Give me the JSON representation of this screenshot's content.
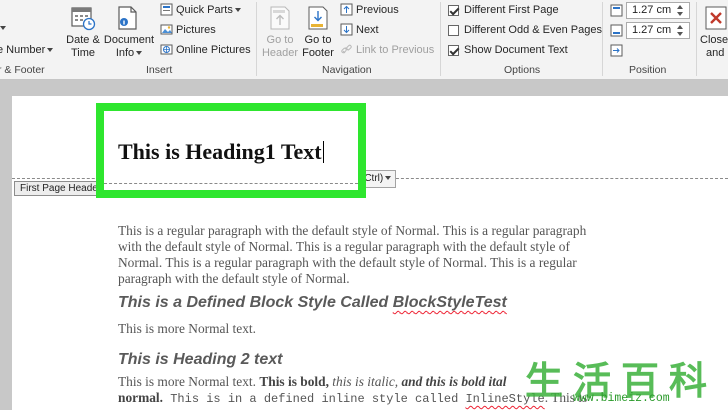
{
  "ribbon": {
    "insert_group": {
      "cut_footer_label": "r & Footer",
      "page_number_label": "e Number",
      "date_time": [
        "Date &",
        "Time"
      ],
      "document_info": [
        "Document",
        "Info"
      ],
      "quick_parts": "Quick Parts",
      "pictures": "Pictures",
      "online_pictures": "Online Pictures",
      "group_label": "Insert"
    },
    "navigation_group": {
      "goto_header": [
        "Go to",
        "Header"
      ],
      "goto_footer": [
        "Go to",
        "Footer"
      ],
      "previous": "Previous",
      "next": "Next",
      "link_to_previous": "Link to Previous",
      "group_label": "Navigation"
    },
    "options_group": {
      "different_first_page": "Different First Page",
      "different_odd_even": "Different Odd & Even Pages",
      "show_document_text": "Show Document Text",
      "checks": [
        true,
        false,
        true
      ],
      "group_label": "Options"
    },
    "position_group": {
      "header_from_top": "1.27 cm",
      "footer_from_bottom": "1.27 cm",
      "group_label": "Position"
    },
    "close_group": {
      "close": [
        "Close",
        "and"
      ]
    }
  },
  "document": {
    "first_page_header_tab": "First Page Header",
    "paste_options": "(Ctrl)",
    "heading1": "This is Heading1 Text",
    "para1_lines": [
      "This is a regular paragraph with the default style of Normal. This is a regular paragraph",
      "with the default style of Normal. This is a regular paragraph with the default style of",
      "Normal. This is a regular paragraph with the default style of Normal. This is a regular",
      "paragraph with the default style of Normal."
    ],
    "block_style_heading": "This is a Defined Block Style Called ",
    "block_style_name": "BlockStyleTest",
    "more_normal": "This is more Normal text.",
    "heading2": "This is Heading 2 text",
    "line_a": {
      "normal": "This is more Normal text. ",
      "bold": "This is bold,",
      "italic": " this is italic,",
      "bold_italic": " and this is bold ital"
    },
    "line_b": {
      "normal": "normal.",
      "mono": " This is in a defined inline style called ",
      "inline_name": "InlineStyle",
      "tail": ". This is"
    }
  },
  "watermark": {
    "glyphs": "生活百科",
    "url": "www.bimeiz.com"
  }
}
